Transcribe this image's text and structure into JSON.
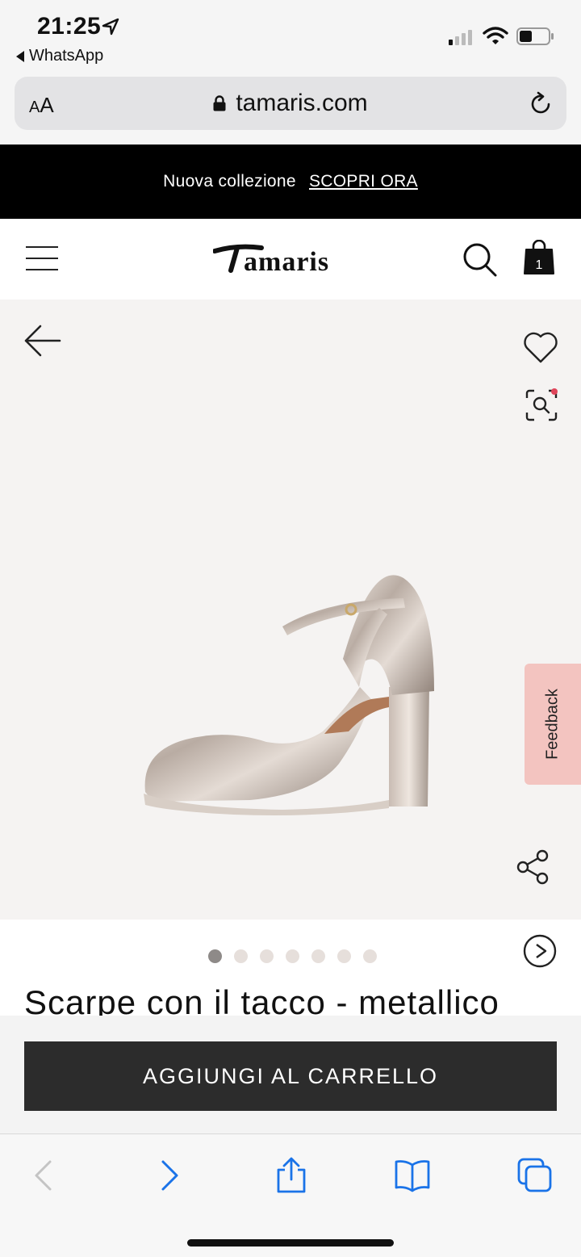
{
  "status_bar": {
    "time": "21:25",
    "back_app": "WhatsApp",
    "signal_bars_on": 1,
    "signal_bars_total": 4,
    "battery_level": 0.45
  },
  "browser": {
    "text_size_label_small": "A",
    "text_size_label_large": "A",
    "url": "tamaris.com"
  },
  "promo": {
    "text": "Nuova collezione",
    "cta": "SCOPRI ORA"
  },
  "header": {
    "logo_text": "Tamaris",
    "cart_count": "1"
  },
  "product": {
    "feedback_label": "Feedback",
    "image_count": 7,
    "active_image": 1,
    "title": "Scarpe con il tacco - metallico",
    "add_to_cart": "AGGIUNGI AL CARRELLO"
  },
  "colors": {
    "promo_bg": "#000000",
    "stage_bg": "#f5f3f2",
    "cart_button": "#2c2c2c",
    "feedback_tab": "#f3c4c0",
    "safari_blue": "#1a73e8"
  }
}
